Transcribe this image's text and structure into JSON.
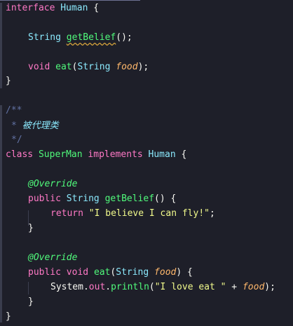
{
  "editor": {
    "language": "Java",
    "theme_colors": {
      "background": "#1e1f29",
      "keyword": "#ff79c6",
      "type": "#8be9fd",
      "function": "#50fa7b",
      "parameter": "#ffb86c",
      "string": "#f1fa8c",
      "comment": "#6272a4"
    },
    "code": {
      "l1": {
        "kw": "interface",
        "name": "Human",
        "brace": "{"
      },
      "l2": {
        "type": "String",
        "fn": "getBelief",
        "rest": "();"
      },
      "l3": {
        "kw": "void",
        "fn": "eat",
        "open": "(",
        "type": "String",
        "param": "food",
        "close": ");"
      },
      "l4": {
        "brace": "}"
      },
      "c1": "/**",
      "c2_star": "*",
      "c2_text": "被代理类",
      "c3": "*/",
      "l5": {
        "kw": "class",
        "name": "SuperMan",
        "kw2": "implements",
        "iface": "Human",
        "brace": "{"
      },
      "l6": {
        "anno": "@Override"
      },
      "l7": {
        "kw": "public",
        "type": "String",
        "fn": "getBelief",
        "rest": "() {"
      },
      "l8": {
        "kw": "return",
        "str": "\"I believe I can fly!\"",
        "end": ";"
      },
      "l9": {
        "brace": "}"
      },
      "l10": {
        "anno": "@Override"
      },
      "l11": {
        "kw": "public",
        "kw2": "void",
        "fn": "eat",
        "open": "(",
        "type": "String",
        "param": "food",
        "close": ") {"
      },
      "l12": {
        "obj": "System",
        "dot1": ".",
        "field": "out",
        "dot2": ".",
        "fn": "println",
        "open": "(",
        "str": "\"I love eat \"",
        "plus": " + ",
        "param": "food",
        "close": ");"
      },
      "l13": {
        "brace": "}"
      },
      "l14": {
        "brace": "}"
      }
    }
  }
}
